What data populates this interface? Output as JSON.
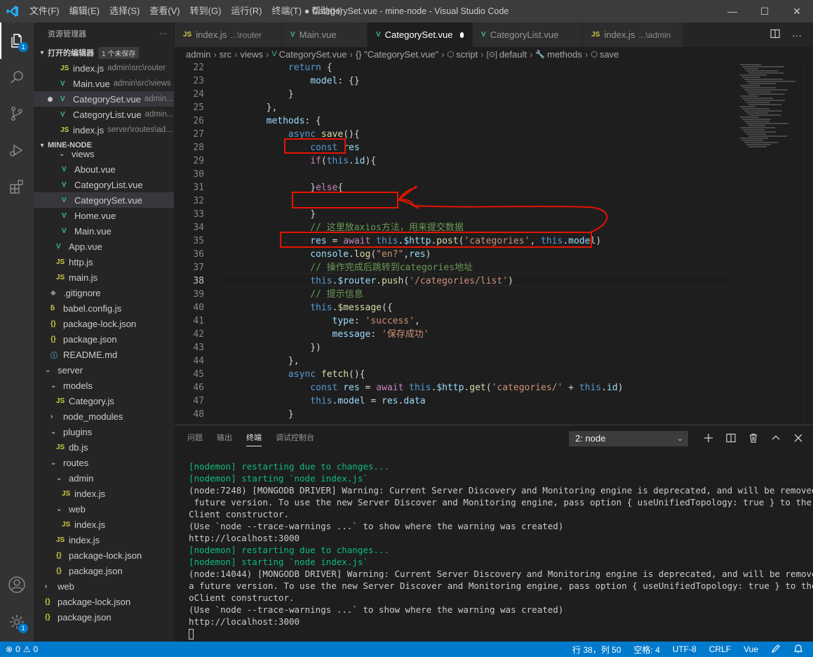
{
  "window": {
    "title": "● CategorySet.vue - mine-node - Visual Studio Code",
    "menu": [
      "文件(F)",
      "编辑(E)",
      "选择(S)",
      "查看(V)",
      "转到(G)",
      "运行(R)",
      "终端(T)",
      "帮助(H)"
    ],
    "controls": {
      "minimize": "—",
      "maximize": "☐",
      "close": "✕"
    }
  },
  "activity": {
    "explorer_badge": "1",
    "settings_badge": "1",
    "icons": [
      "files-icon",
      "search-icon",
      "source-control-icon",
      "run-debug-icon",
      "extensions-icon",
      "account-icon",
      "settings-gear-icon"
    ]
  },
  "sidebar": {
    "title": "资源管理器",
    "more": "···",
    "open_editors_label": "打开的编辑器",
    "unsaved_badge": "1 个未保存",
    "open_editors": [
      {
        "icon": "JS",
        "name": "index.js",
        "desc": "admin\\src\\router"
      },
      {
        "icon": "V",
        "name": "Main.vue",
        "desc": "admin\\src\\views"
      },
      {
        "icon": "V",
        "name": "CategorySet.vue",
        "desc": "admin..."
      },
      {
        "icon": "V",
        "name": "CategoryList.vue",
        "desc": "admin..."
      },
      {
        "icon": "JS",
        "name": "index.js",
        "desc": "server\\routes\\ad..."
      }
    ],
    "project_label": "MINE-NODE",
    "tree": [
      {
        "icon": "fold",
        "name": "views"
      },
      {
        "icon": "V",
        "name": "About.vue"
      },
      {
        "icon": "V",
        "name": "CategoryList.vue"
      },
      {
        "icon": "V",
        "name": "CategorySet.vue"
      },
      {
        "icon": "V",
        "name": "Home.vue"
      },
      {
        "icon": "V",
        "name": "Main.vue"
      },
      {
        "icon": "V",
        "name": "App.vue"
      },
      {
        "icon": "JS",
        "name": "http.js"
      },
      {
        "icon": "JS",
        "name": "main.js"
      },
      {
        "icon": "git",
        "name": ".gitignore"
      },
      {
        "icon": "babel",
        "name": "babel.config.js"
      },
      {
        "icon": "{}",
        "name": "package-lock.json"
      },
      {
        "icon": "{}",
        "name": "package.json"
      },
      {
        "icon": "md",
        "name": "README.md"
      },
      {
        "icon": "fold-open",
        "name": "server"
      },
      {
        "icon": "fold-open",
        "name": "models"
      },
      {
        "icon": "JS",
        "name": "Category.js"
      },
      {
        "icon": "fold-closed",
        "name": "node_modules"
      },
      {
        "icon": "fold-open",
        "name": "plugins"
      },
      {
        "icon": "JS",
        "name": "db.js"
      },
      {
        "icon": "fold-open",
        "name": "routes"
      },
      {
        "icon": "fold-open",
        "name": "admin"
      },
      {
        "icon": "JS",
        "name": "index.js"
      },
      {
        "icon": "fold-open",
        "name": "web"
      },
      {
        "icon": "JS",
        "name": "index.js"
      },
      {
        "icon": "JS",
        "name": "index.js"
      },
      {
        "icon": "{}",
        "name": "package-lock.json"
      },
      {
        "icon": "{}",
        "name": "package.json"
      },
      {
        "icon": "fold-closed",
        "name": "web"
      },
      {
        "icon": "{}",
        "name": "package-lock.json"
      },
      {
        "icon": "{}",
        "name": "package.json"
      }
    ]
  },
  "tabs": [
    {
      "icon": "JS",
      "name": "index.js",
      "desc": "...\\router"
    },
    {
      "icon": "V",
      "name": "Main.vue",
      "desc": ""
    },
    {
      "icon": "V",
      "name": "CategorySet.vue",
      "desc": ""
    },
    {
      "icon": "V",
      "name": "CategoryList.vue",
      "desc": ""
    },
    {
      "icon": "JS",
      "name": "index.js",
      "desc": "...\\admin"
    }
  ],
  "breadcrumb": [
    "admin",
    "src",
    "views",
    "CategorySet.vue",
    "{} \"CategorySet.vue\"",
    "script",
    "default",
    "methods",
    "save"
  ],
  "editor": {
    "line_numbers": [
      "22",
      "23",
      "24",
      "25",
      "26",
      "27",
      "28",
      "29",
      "30",
      "31",
      "32",
      "33",
      "34",
      "35",
      "36",
      "37",
      "38",
      "39",
      "40",
      "41",
      "42",
      "43",
      "44",
      "45",
      "46",
      "47",
      "48"
    ],
    "current_line": "38",
    "lines": [
      [
        [
          "k",
          "            return"
        ],
        [
          "p",
          " {"
        ]
      ],
      [
        [
          "v",
          "                model"
        ],
        [
          "p",
          ": {}"
        ]
      ],
      [
        [
          "p",
          "            }"
        ]
      ],
      [
        [
          "p",
          "        },"
        ]
      ],
      [
        [
          "v",
          "        methods"
        ],
        [
          "p",
          ": {"
        ]
      ],
      [
        [
          "k",
          "            async"
        ],
        [
          "p",
          " "
        ],
        [
          "f",
          "save"
        ],
        [
          "p",
          "(){"
        ]
      ],
      [
        [
          "k",
          "                const"
        ],
        [
          "p",
          " "
        ],
        [
          "v",
          "res"
        ]
      ],
      [
        [
          "kc",
          "                if"
        ],
        [
          "p",
          "("
        ],
        [
          "k",
          "this"
        ],
        [
          "p",
          "."
        ],
        [
          "v",
          "id"
        ],
        [
          "p",
          "){"
        ]
      ],
      [
        [
          "p",
          ""
        ]
      ],
      [
        [
          "p",
          "                }"
        ],
        [
          "kc",
          "else"
        ],
        [
          "p",
          "{"
        ]
      ],
      [
        [
          "p",
          ""
        ]
      ],
      [
        [
          "p",
          "                }"
        ]
      ],
      [
        [
          "c",
          "                // 这里放axios方法，用来提交数据"
        ]
      ],
      [
        [
          "v",
          "                res"
        ],
        [
          "p",
          " = "
        ],
        [
          "kc",
          "await"
        ],
        [
          "p",
          " "
        ],
        [
          "k",
          "this"
        ],
        [
          "p",
          "."
        ],
        [
          "v",
          "$http"
        ],
        [
          "p",
          "."
        ],
        [
          "f",
          "post"
        ],
        [
          "p",
          "("
        ],
        [
          "s",
          "'categories'"
        ],
        [
          "p",
          ", "
        ],
        [
          "k",
          "this"
        ],
        [
          "p",
          "."
        ],
        [
          "v",
          "model"
        ],
        [
          "p",
          ")"
        ]
      ],
      [
        [
          "v",
          "                console"
        ],
        [
          "p",
          "."
        ],
        [
          "f",
          "log"
        ],
        [
          "p",
          "("
        ],
        [
          "s",
          "\"en?\""
        ],
        [
          "p",
          ","
        ],
        [
          "v",
          "res"
        ],
        [
          "p",
          ")"
        ]
      ],
      [
        [
          "c",
          "                // 操作完成后跳转到categories地址"
        ]
      ],
      [
        [
          "k",
          "                this"
        ],
        [
          "p",
          "."
        ],
        [
          "v",
          "$router"
        ],
        [
          "p",
          "."
        ],
        [
          "f",
          "push"
        ],
        [
          "p",
          "("
        ],
        [
          "s",
          "'/categories/list'"
        ],
        [
          "p",
          ")"
        ]
      ],
      [
        [
          "c",
          "                // 提示信息"
        ]
      ],
      [
        [
          "k",
          "                this"
        ],
        [
          "p",
          "."
        ],
        [
          "f",
          "$message"
        ],
        [
          "p",
          "({"
        ]
      ],
      [
        [
          "v",
          "                    type"
        ],
        [
          "p",
          ": "
        ],
        [
          "s",
          "'success'"
        ],
        [
          "p",
          ","
        ]
      ],
      [
        [
          "v",
          "                    message"
        ],
        [
          "p",
          ": "
        ],
        [
          "s",
          "'保存成功'"
        ]
      ],
      [
        [
          "p",
          "                })"
        ]
      ],
      [
        [
          "p",
          "            },"
        ]
      ],
      [
        [
          "k",
          "            async"
        ],
        [
          "p",
          " "
        ],
        [
          "f",
          "fetch"
        ],
        [
          "p",
          "(){"
        ]
      ],
      [
        [
          "k",
          "                const"
        ],
        [
          "p",
          " "
        ],
        [
          "v",
          "res"
        ],
        [
          "p",
          " = "
        ],
        [
          "kc",
          "await"
        ],
        [
          "p",
          " "
        ],
        [
          "k",
          "this"
        ],
        [
          "p",
          "."
        ],
        [
          "v",
          "$http"
        ],
        [
          "p",
          "."
        ],
        [
          "f",
          "get"
        ],
        [
          "p",
          "("
        ],
        [
          "s",
          "'categories/'"
        ],
        [
          "p",
          " + "
        ],
        [
          "k",
          "this"
        ],
        [
          "p",
          "."
        ],
        [
          "v",
          "id"
        ],
        [
          "p",
          ")"
        ]
      ],
      [
        [
          "k",
          "                this"
        ],
        [
          "p",
          "."
        ],
        [
          "v",
          "model"
        ],
        [
          "p",
          " = "
        ],
        [
          "v",
          "res"
        ],
        [
          "p",
          "."
        ],
        [
          "v",
          "data"
        ]
      ],
      [
        [
          "p",
          "            }"
        ]
      ]
    ]
  },
  "panel": {
    "tabs": [
      "问题",
      "输出",
      "终端",
      "调试控制台"
    ],
    "active_tab": "终端",
    "terminal_select": "2: node",
    "icons": [
      "plus-icon",
      "split-icon",
      "trash-icon",
      "chevron-up-icon",
      "close-icon"
    ],
    "terminal_lines": [
      {
        "style": "green",
        "text": "[nodemon] restarting due to changes..."
      },
      {
        "style": "green",
        "text": "[nodemon] starting `node index.js`"
      },
      {
        "style": "",
        "text": "(node:7248) [MONGODB DRIVER] Warning: Current Server Discovery and Monitoring engine is deprecated, and will be removed in a"
      },
      {
        "style": "",
        "text": " future version. To use the new Server Discover and Monitoring engine, pass option { useUnifiedTopology: true } to the Mongo"
      },
      {
        "style": "",
        "text": "Client constructor."
      },
      {
        "style": "",
        "text": "(Use `node --trace-warnings ...` to show where the warning was created)"
      },
      {
        "style": "",
        "text": "http://localhost:3000"
      },
      {
        "style": "green",
        "text": "[nodemon] restarting due to changes..."
      },
      {
        "style": "green",
        "text": "[nodemon] starting `node index.js`"
      },
      {
        "style": "",
        "text": "(node:14044) [MONGODB DRIVER] Warning: Current Server Discovery and Monitoring engine is deprecated, and will be removed in"
      },
      {
        "style": "",
        "text": "a future version. To use the new Server Discover and Monitoring engine, pass option { useUnifiedTopology: true } to the Mong"
      },
      {
        "style": "",
        "text": "oClient constructor."
      },
      {
        "style": "",
        "text": "(Use `node --trace-warnings ...` to show where the warning was created)"
      },
      {
        "style": "",
        "text": "http://localhost:3000"
      }
    ]
  },
  "status": {
    "errors": "0",
    "warnings": "0",
    "position": "行 38，列 50",
    "spaces": "空格: 4",
    "encoding": "UTF-8",
    "eol": "CRLF",
    "language": "Vue"
  },
  "colors": {
    "accent": "#007acc",
    "annotation": "#e51400"
  }
}
